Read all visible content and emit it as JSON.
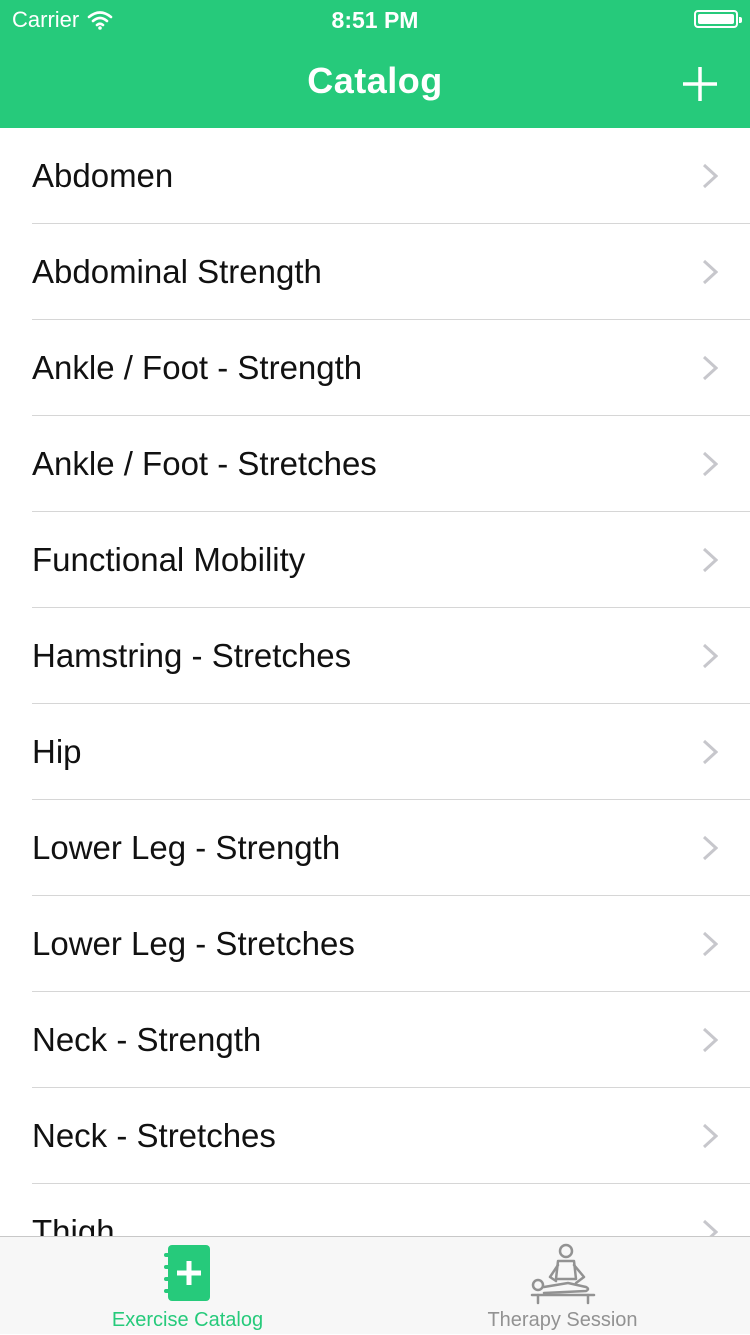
{
  "status_bar": {
    "carrier": "Carrier",
    "time": "8:51 PM",
    "wifi_icon": "wifi-icon",
    "battery_icon": "battery-icon"
  },
  "nav": {
    "title": "Catalog",
    "add_icon": "plus-icon"
  },
  "colors": {
    "accent": "#26ca7b",
    "separator": "#d6d6d6",
    "chevron": "#c7c7cc",
    "tab_inactive": "#929292"
  },
  "catalog": {
    "items": [
      {
        "label": "Abdomen"
      },
      {
        "label": "Abdominal Strength"
      },
      {
        "label": "Ankle / Foot - Strength"
      },
      {
        "label": "Ankle / Foot - Stretches"
      },
      {
        "label": "Functional Mobility"
      },
      {
        "label": "Hamstring - Stretches"
      },
      {
        "label": "Hip"
      },
      {
        "label": "Lower Leg - Strength"
      },
      {
        "label": "Lower Leg - Stretches"
      },
      {
        "label": "Neck - Strength"
      },
      {
        "label": "Neck - Stretches"
      },
      {
        "label": "Thigh"
      }
    ]
  },
  "tabs": [
    {
      "label": "Exercise Catalog",
      "icon": "notebook-plus-icon",
      "active": true
    },
    {
      "label": "Therapy Session",
      "icon": "massage-therapy-icon",
      "active": false
    }
  ]
}
